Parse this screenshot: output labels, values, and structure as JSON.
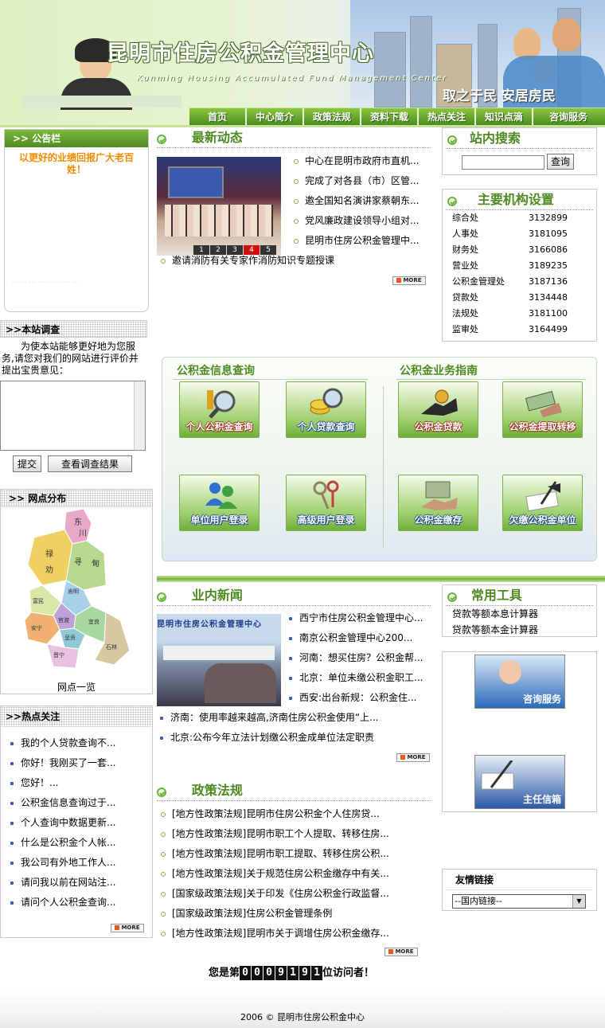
{
  "header": {
    "title": "昆明市住房公积金管理中心",
    "subtitle": "Kunming Housing Accumulated Fund Management Center",
    "slogan": "取之于民 安居房民",
    "nav": [
      "首页",
      "中心简介",
      "政策法规",
      "资料下载",
      "热点关注",
      "知识点滴",
      "咨询服务"
    ]
  },
  "notice": {
    "title": ">> 公告栏",
    "text": "以更好的业绩回报广大老百姓！",
    "faded": "……………………"
  },
  "survey": {
    "title": ">>本站调查",
    "text": "为使本站能够更好地为您服务,请您对我们的网站进行评价并提出宝贵意见：",
    "submit": "提交",
    "results": "查看调查结果"
  },
  "branches": {
    "title": ">> 网点分布",
    "caption": "网点一览",
    "map_labels": [
      "东",
      "川",
      "禄",
      "劝",
      "寻",
      "甸",
      "嵩",
      "明",
      "富民",
      "官渡",
      "安宁",
      "晋宁",
      "呈贡",
      "宜良",
      "石林"
    ]
  },
  "hot": {
    "title": ">>热点关注",
    "items": [
      "我的个人贷款查询不...",
      "你好！我刚买了一套...",
      "您好！...",
      "公积金信息查询过于...",
      "个人查询中数据更新...",
      "什么是公积金个人帐...",
      "我公司有外地工作人...",
      "请问我以前在网站注...",
      "请问个人公积金查询..."
    ],
    "more": "MORE"
  },
  "latest": {
    "title": "最新动态",
    "pager": [
      "1",
      "2",
      "3",
      "4",
      "5"
    ],
    "active_page": "4",
    "items": [
      "中心在昆明市政府市直机...",
      "完成了对各县（市）区管...",
      "邀全国知名演讲家蔡朝东...",
      "党风廉政建设领导小组对...",
      "昆明市住房公积金管理中..."
    ],
    "extra": "邀请消防有关专家作消防知识专题授课",
    "more": "MORE"
  },
  "search": {
    "title": "站内搜索",
    "placeholder": "",
    "button": "查询"
  },
  "orgs": {
    "title": "主要机构设置",
    "rows": [
      {
        "name": "综合处",
        "phone": "3132899"
      },
      {
        "name": "人事处",
        "phone": "3181095"
      },
      {
        "name": "财务处",
        "phone": "3166086"
      },
      {
        "name": "营业处",
        "phone": "3189235"
      },
      {
        "name": "公积金管理处",
        "phone": "3187136"
      },
      {
        "name": "贷款处",
        "phone": "3134448"
      },
      {
        "name": "法规处",
        "phone": "3181100"
      },
      {
        "name": "监审处",
        "phone": "3164499"
      }
    ]
  },
  "services": {
    "left_title": "公积金信息查询",
    "right_title": "公积金业务指南",
    "tiles": [
      "个人公积金查询",
      "个人贷款查询",
      "公积金贷款",
      "公积金提取转移",
      "单位用户登录",
      "高级用户登录",
      "公积金缴存",
      "欠缴公积金单位"
    ]
  },
  "industry": {
    "title": "业内新闻",
    "photo_text": "昆明市住房公积金管理中心",
    "items": [
      "西宁市住房公积金管理中心...",
      "南京公积金管理中心200...",
      "河南：想买住房？公积金帮...",
      "北京：单位未缴公积金职工...",
      "西安:出台新规：公积金住..."
    ],
    "extra": [
      "济南：使用率越来越高,济南住房公积金使用“上...",
      "北京:公布今年立法计划缴公积金成单位法定职责"
    ],
    "more": "MORE"
  },
  "tools": {
    "title": "常用工具",
    "items": [
      "贷款等额本息计算器",
      "贷款等额本金计算器"
    ],
    "consult": "咨询服务",
    "director": "主任信箱"
  },
  "policy": {
    "title": "政策法规",
    "items": [
      "[地方性政策法规]昆明市住房公积金个人住房贷...",
      "[地方性政策法规]昆明市职工个人提取、转移住房...",
      "[地方性政策法规]昆明市职工提取、转移住房公积...",
      "[地方性政策法规]关于规范住房公积金缴存中有关...",
      "[国家级政策法规]关于印发《住房公积金行政监督...",
      "[国家级政策法规]住房公积金管理条例",
      "[地方性政策法规]昆明市关于调增住房公积金缴存..."
    ],
    "more": "MORE"
  },
  "links": {
    "title": "友情链接",
    "select": "--国内链接--"
  },
  "counter": {
    "prefix": "您是第",
    "digits": [
      "0",
      "0",
      "0",
      "9",
      "1",
      "9",
      "1"
    ],
    "suffix": "位访问者！"
  },
  "footer": {
    "text": "2006 © 昆明市住房公积金中心"
  },
  "colors": {
    "accent": "#4f8a22",
    "nav": "#5aa02a",
    "notice_text": "#f08c00"
  }
}
